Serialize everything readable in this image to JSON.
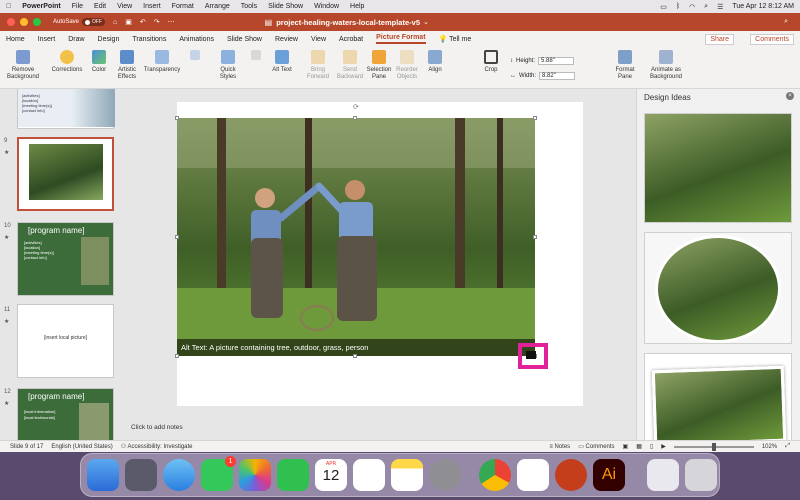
{
  "menubar": {
    "app": "PowerPoint",
    "items": [
      "File",
      "Edit",
      "View",
      "Insert",
      "Format",
      "Arrange",
      "Tools",
      "Slide Show",
      "Window",
      "Help"
    ],
    "datetime": "Tue Apr 12  8:12 AM"
  },
  "titlebar": {
    "autosave": "AutoSave",
    "autosave_state": "OFF",
    "filename": "project-healing-waters-local-template-v5"
  },
  "tabs": {
    "items": [
      "Home",
      "Insert",
      "Draw",
      "Design",
      "Transitions",
      "Animations",
      "Slide Show",
      "Review",
      "View",
      "Acrobat",
      "Picture Format"
    ],
    "tell_me": "Tell me",
    "share": "Share",
    "comments": "Comments"
  },
  "ribbon": {
    "remove_bg": "Remove Background",
    "corrections": "Corrections",
    "color": "Color",
    "artistic": "Artistic Effects",
    "transparency": "Transparency",
    "quick_styles": "Quick Styles",
    "alt_text": "Alt Text",
    "bring_forward": "Bring Forward",
    "send_backward": "Send Backward",
    "selection_pane": "Selection Pane",
    "reorder": "Reorder Objects",
    "align": "Align",
    "crop": "Crop",
    "height_label": "Height:",
    "height_value": "5.88\"",
    "width_label": "Width:",
    "width_value": "8.82\"",
    "format_pane": "Format Pane",
    "animate_bg": "Animate as Background"
  },
  "thumbnails": [
    {
      "num": "8",
      "lines": [
        "[activities]",
        "[location]",
        "[meeting time(s)]",
        "[contact info]"
      ]
    },
    {
      "num": "9"
    },
    {
      "num": "10",
      "title": "[program name]",
      "lines": [
        "[activities]",
        "[location]",
        "[meeting time(s)]",
        "[contact info]"
      ]
    },
    {
      "num": "11",
      "placeholder": "[insert local picture]"
    },
    {
      "num": "12",
      "title": "[program name]",
      "lines": [
        "[local information]",
        "[local testimonial]"
      ]
    }
  ],
  "slide": {
    "alt_text": "Alt Text: A picture containing tree, outdoor, grass, person",
    "notes": "Click to add notes"
  },
  "design_panel": {
    "title": "Design Ideas"
  },
  "status": {
    "slide": "Slide 9 of 17",
    "language": "English (United States)",
    "accessibility": "Accessibility: Investigate",
    "notes": "Notes",
    "comments": "Comments",
    "zoom": "102%"
  },
  "dock": {
    "calendar_month": "APR",
    "calendar_day": "12",
    "messages_badge": "1"
  },
  "colors": {
    "accent": "#b7472a",
    "highlight": "#e0219a"
  }
}
